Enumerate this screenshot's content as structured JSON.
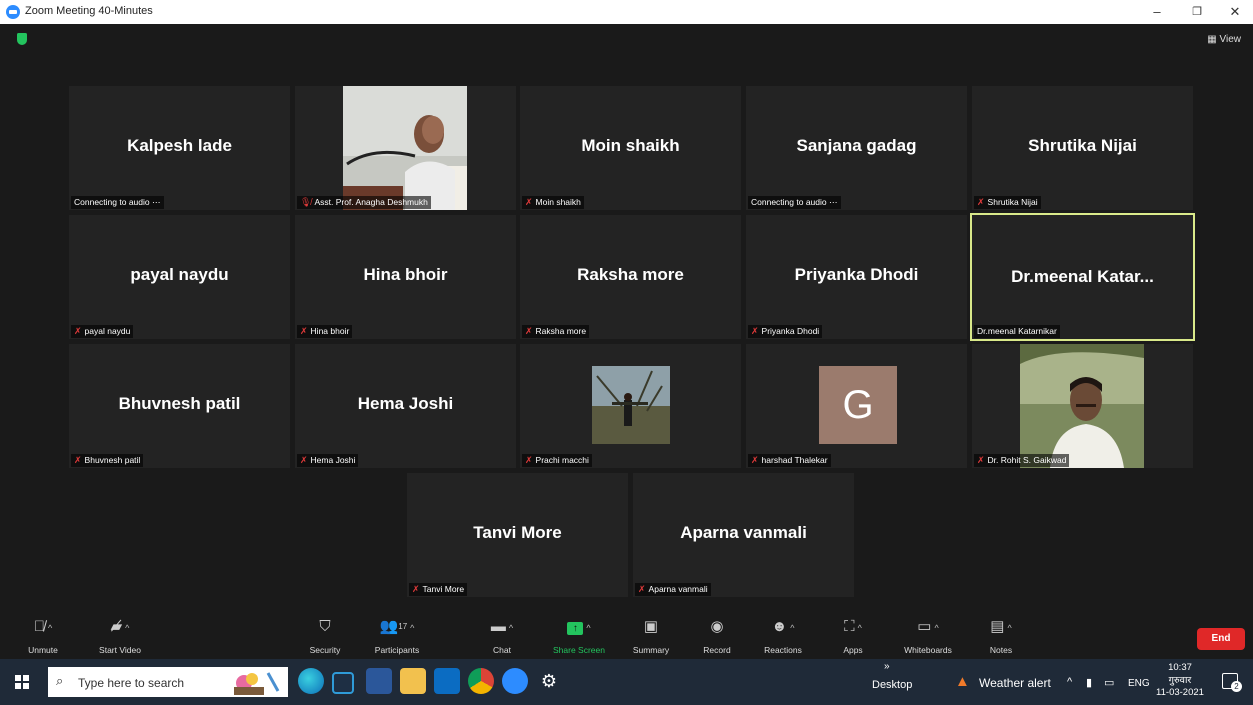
{
  "window": {
    "title": "Zoom Meeting 40-Minutes",
    "minimize": "–",
    "restore": "❐",
    "close": "✕"
  },
  "view_label": "View",
  "tiles": [
    {
      "name": "Kalpesh lade",
      "label": "Connecting to audio",
      "muted": false
    },
    {
      "name": "",
      "label": "Asst. Prof. Anagha Deshmukh",
      "muted": true
    },
    {
      "name": "Moin shaikh",
      "label": "Moin shaikh",
      "muted": true
    },
    {
      "name": "Sanjana gadag",
      "label": "Connecting to audio",
      "muted": false
    },
    {
      "name": "Shrutika Nijai",
      "label": "Shrutika Nijai",
      "muted": true
    },
    {
      "name": "payal naydu",
      "label": "payal naydu",
      "muted": true
    },
    {
      "name": "Hina bhoir",
      "label": "Hina bhoir",
      "muted": true
    },
    {
      "name": "Raksha more",
      "label": "Raksha more",
      "muted": true
    },
    {
      "name": "Priyanka Dhodi",
      "label": "Priyanka Dhodi",
      "muted": true
    },
    {
      "name": "Dr.meenal Katar...",
      "label": "Dr.meenal Katarnikar",
      "muted": false
    },
    {
      "name": "Bhuvnesh patil",
      "label": "Bhuvnesh patil",
      "muted": true
    },
    {
      "name": "Hema Joshi",
      "label": "Hema Joshi",
      "muted": true
    },
    {
      "name": "",
      "label": "Prachi macchi",
      "muted": true
    },
    {
      "name": "",
      "label": "harshad Thalekar",
      "muted": true,
      "avatar_letter": "G"
    },
    {
      "name": "",
      "label": "Dr. Rohit S. Gaikwad",
      "muted": true
    },
    {
      "name": "Tanvi More",
      "label": "Tanvi More",
      "muted": true
    },
    {
      "name": "Aparna vanmali",
      "label": "Aparna vanmali",
      "muted": true
    }
  ],
  "toolbar": {
    "unmute": "Unmute",
    "start_video": "Start Video",
    "security": "Security",
    "participants": "Participants",
    "participants_count": "17",
    "chat": "Chat",
    "share_screen": "Share Screen",
    "summary": "Summary",
    "record": "Record",
    "reactions": "Reactions",
    "apps": "Apps",
    "whiteboards": "Whiteboards",
    "notes": "Notes",
    "end": "End"
  },
  "taskbar": {
    "search_placeholder": "Type here to search",
    "desktop": "Desktop",
    "chevron": "»",
    "weather": "Weather alert",
    "lang": "ENG",
    "time": "10:37",
    "day": "गुरुवार",
    "date": "11-03-2021",
    "notif_count": "2"
  },
  "colors": {
    "share_green": "#23c45e",
    "end_red": "#e02828",
    "active_border": "#d9e98a",
    "muted_mic": "#e03a3a"
  }
}
